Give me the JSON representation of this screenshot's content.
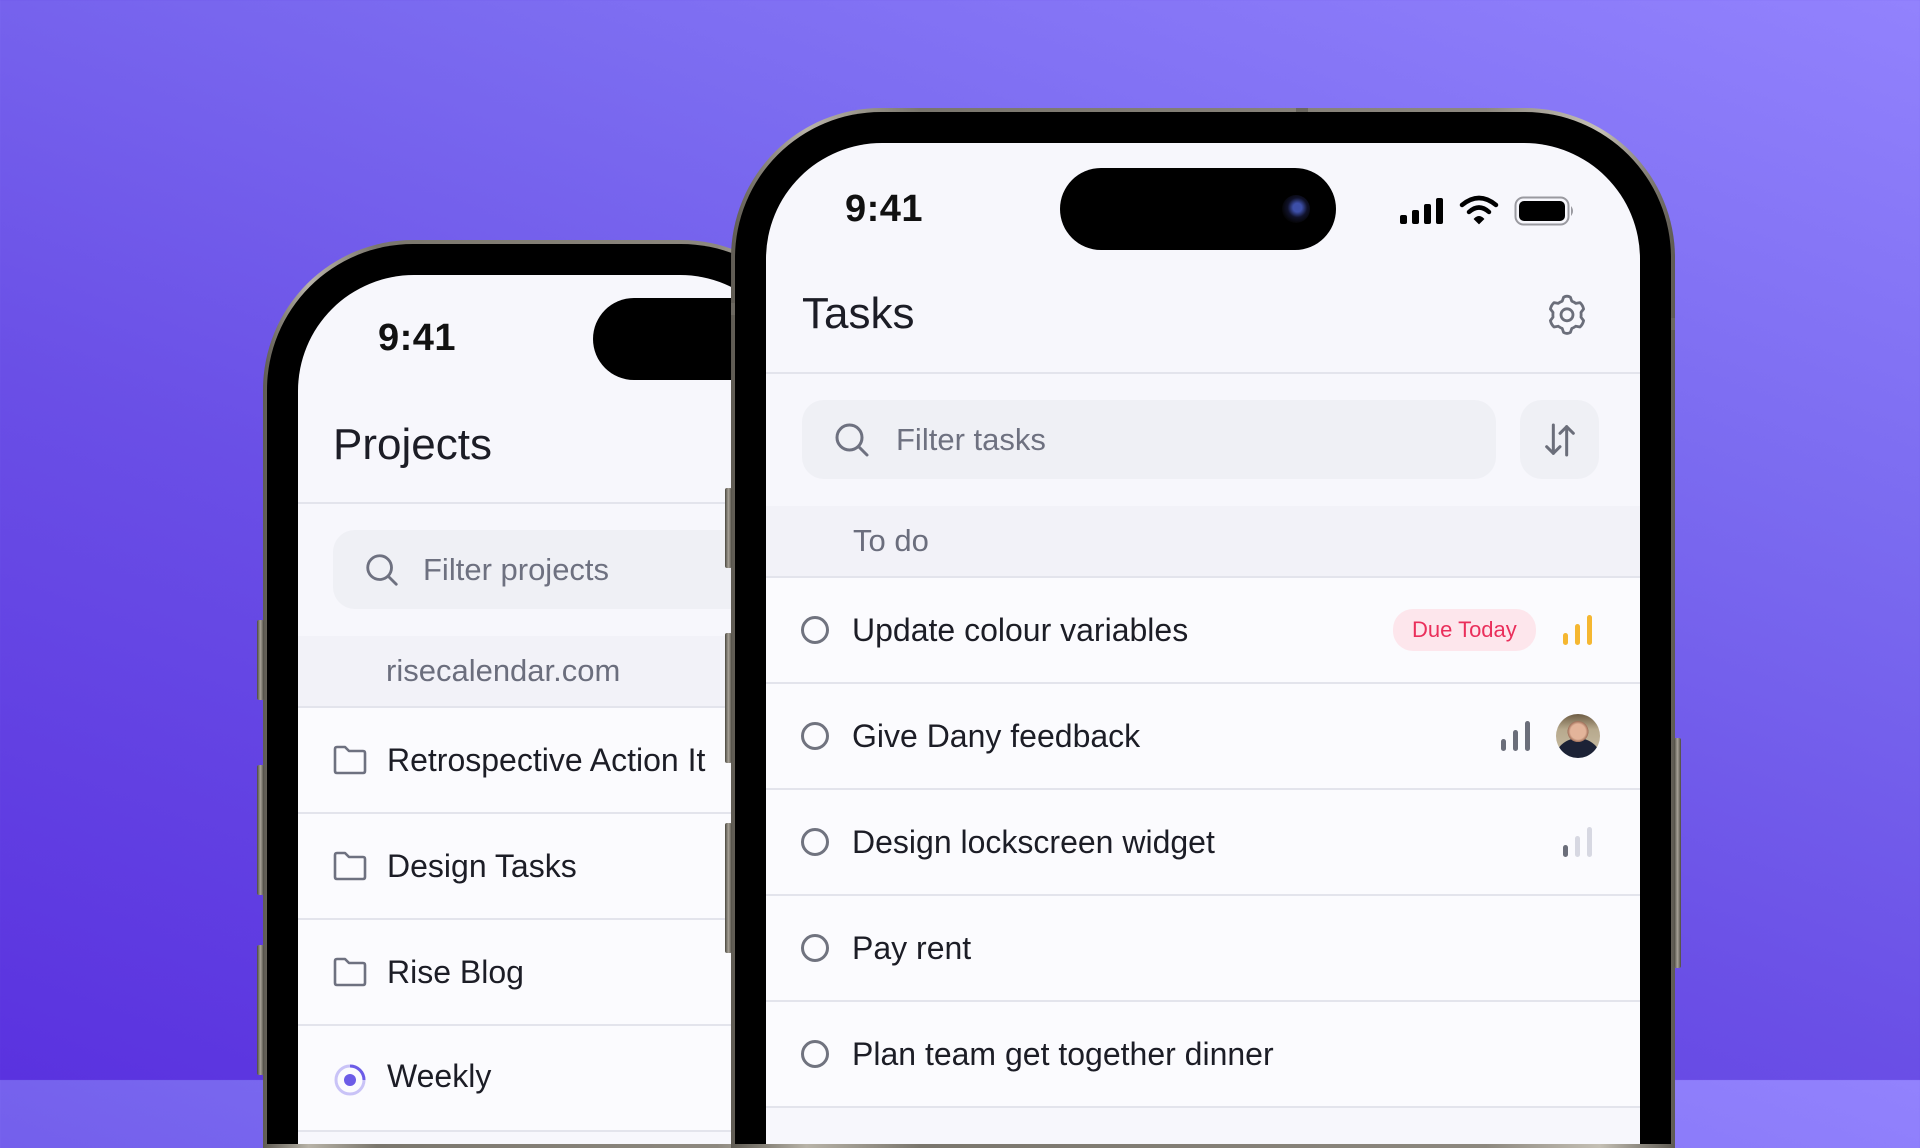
{
  "background": {
    "gradient_colors": [
      "#9282fd",
      "#7b6bf0",
      "#5a32df"
    ]
  },
  "phone_left": {
    "status_bar": {
      "time": "9:41"
    },
    "header": {
      "title": "Projects"
    },
    "search": {
      "placeholder": "Filter projects",
      "icon": "search-icon"
    },
    "section": {
      "label": "risecalendar.com"
    },
    "projects": [
      {
        "label": "Retrospective Action It",
        "icon": "folder-icon"
      },
      {
        "label": "Design Tasks",
        "icon": "folder-icon"
      },
      {
        "label": "Rise Blog",
        "icon": "folder-icon"
      },
      {
        "label": "Weekly",
        "icon": "progress-ring-icon"
      }
    ]
  },
  "phone_right": {
    "status_bar": {
      "time": "9:41",
      "icons": [
        "cellular-signal-icon",
        "wifi-icon",
        "battery-icon"
      ]
    },
    "header": {
      "title": "Tasks",
      "settings_icon": "gear-icon"
    },
    "search": {
      "placeholder": "Filter tasks",
      "icon": "search-icon"
    },
    "sort_button": {
      "icon": "sort-arrows-icon"
    },
    "section": {
      "label": "To do"
    },
    "tasks": [
      {
        "label": "Update colour variables",
        "badge": "Due Today",
        "priority": "high",
        "priority_color": "#f5b731",
        "assignee": null
      },
      {
        "label": "Give Dany feedback",
        "badge": null,
        "priority": "medium",
        "priority_color": "#6b6e7a",
        "assignee": "avatar"
      },
      {
        "label": "Design lockscreen widget",
        "badge": null,
        "priority": "low",
        "priority_color": "#6b6e7a",
        "assignee": null
      },
      {
        "label": "Pay rent",
        "badge": null,
        "priority": null,
        "assignee": null
      },
      {
        "label": "Plan team get together dinner",
        "badge": null,
        "priority": null,
        "assignee": null
      }
    ],
    "colors": {
      "badge_bg": "#fde6ec",
      "badge_text": "#ea2f5b",
      "accent": "#6c5ce7"
    }
  }
}
